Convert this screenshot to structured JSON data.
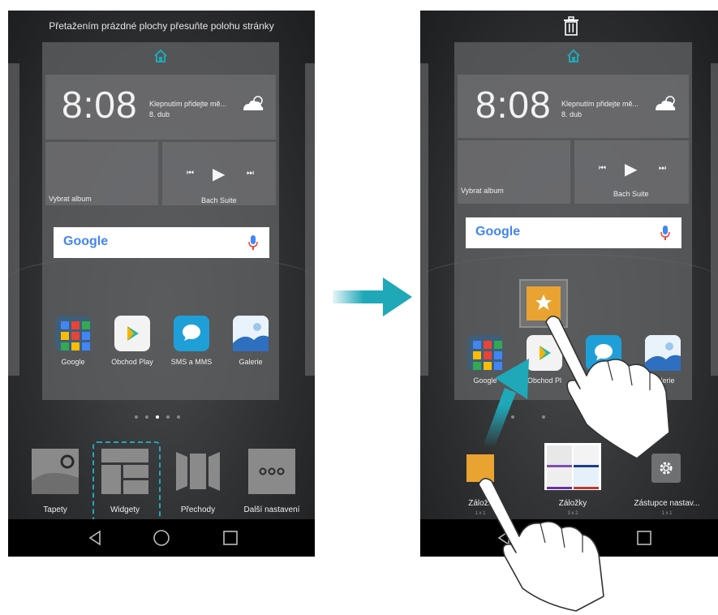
{
  "left_screen": {
    "hint": "Přetažením prázdné plochy přesuňte polohu stránky",
    "clock": "8:08",
    "weather_text": "Klepnutím přidejte mě...",
    "date": "8. dub",
    "music_left_label": "Vybrat album",
    "music_track": "Bach Suite",
    "google_logo": "Google",
    "apps": [
      "Google",
      "Obchod Play",
      "SMS a MMS",
      "Galerie"
    ],
    "tools": [
      "Tapety",
      "Widgety",
      "Přechody",
      "Další nastavení"
    ]
  },
  "right_screen": {
    "clock": "8:08",
    "weather_text": "Klepnutím přidejte mě...",
    "date": "8. dub",
    "music_left_label": "Vybrat album",
    "music_track": "Bach Suite",
    "google_logo": "Google",
    "apps": [
      "Google",
      "Obchod Pl",
      "",
      "Galerie"
    ],
    "widgets": [
      {
        "label": "Záložk",
        "size": "1 x 1"
      },
      {
        "label": "Záložky",
        "size": "3 x 2"
      },
      {
        "label": "Zástupce nastav...",
        "size": "1 x 1"
      }
    ]
  },
  "colors": {
    "accent": "#1fa8b8",
    "widget_orange": "#e9a331"
  }
}
